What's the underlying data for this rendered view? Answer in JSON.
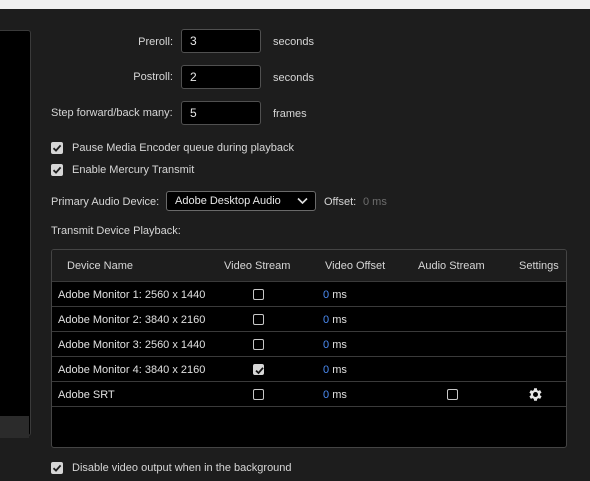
{
  "fields": {
    "preroll": {
      "label": "Preroll:",
      "value": "3",
      "unit": "seconds"
    },
    "postroll": {
      "label": "Postroll:",
      "value": "2",
      "unit": "seconds"
    },
    "step": {
      "label": "Step forward/back many:",
      "value": "5",
      "unit": "frames"
    }
  },
  "checks": {
    "pause_encoder": {
      "label": "Pause Media Encoder queue during playback",
      "checked": true
    },
    "mercury": {
      "label": "Enable Mercury Transmit",
      "checked": true
    },
    "disable_bg": {
      "label": "Disable video output when in the background",
      "checked": true
    }
  },
  "audio": {
    "label": "Primary Audio Device:",
    "selected": "Adobe Desktop Audio",
    "offset_label": "Offset:",
    "offset_value": "0 ms"
  },
  "transmit_label": "Transmit Device Playback:",
  "table": {
    "headers": [
      "Device Name",
      "Video Stream",
      "Video Offset",
      "Audio Stream",
      "Settings"
    ],
    "rows": [
      {
        "name": "Adobe Monitor 1: 2560 x 1440",
        "video_stream": false,
        "offset": "0",
        "unit": "ms"
      },
      {
        "name": "Adobe Monitor 2: 3840 x 2160",
        "video_stream": false,
        "offset": "0",
        "unit": "ms"
      },
      {
        "name": "Adobe Monitor 3: 2560 x 1440",
        "video_stream": false,
        "offset": "0",
        "unit": "ms"
      },
      {
        "name": "Adobe Monitor 4: 3840 x 2160",
        "video_stream": true,
        "offset": "0",
        "unit": "ms"
      },
      {
        "name": "Adobe SRT",
        "video_stream": false,
        "offset": "0",
        "unit": "ms",
        "audio_stream": false,
        "settings_icon": "gear-icon"
      }
    ]
  },
  "colors": {
    "accent": "#4b8cf5",
    "background": "#1d1d1d",
    "field": "#000000"
  }
}
